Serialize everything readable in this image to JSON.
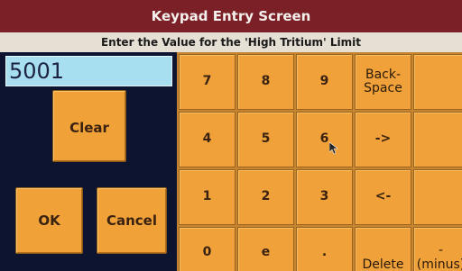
{
  "window": {
    "title": "Keypad Entry Screen"
  },
  "prompt": "Enter the Value for the 'High Tritium' Limit",
  "value_field": {
    "value": "5001"
  },
  "buttons": {
    "clear": "Clear",
    "ok": "OK",
    "cancel": "Cancel"
  },
  "keypad": {
    "keys": [
      {
        "name": "key-7",
        "label": "7"
      },
      {
        "name": "key-8",
        "label": "8"
      },
      {
        "name": "key-9",
        "label": "9"
      },
      {
        "name": "key-backspace",
        "label": "Back-\nSpace",
        "text": true
      },
      {
        "name": "key-blank-1",
        "label": "",
        "blank": true
      },
      {
        "name": "key-4",
        "label": "4"
      },
      {
        "name": "key-5",
        "label": "5"
      },
      {
        "name": "key-6",
        "label": "6"
      },
      {
        "name": "key-cursor-right",
        "label": "->"
      },
      {
        "name": "key-blank-2",
        "label": "",
        "blank": true
      },
      {
        "name": "key-1",
        "label": "1"
      },
      {
        "name": "key-2",
        "label": "2"
      },
      {
        "name": "key-3",
        "label": "3"
      },
      {
        "name": "key-cursor-left",
        "label": "<-"
      },
      {
        "name": "key-blank-3",
        "label": "",
        "blank": true
      },
      {
        "name": "key-0",
        "label": "0"
      },
      {
        "name": "key-e",
        "label": "e"
      },
      {
        "name": "key-decimal",
        "label": "."
      },
      {
        "name": "key-delete",
        "label": "Delete",
        "text": true,
        "bottom": true
      },
      {
        "name": "key-minus",
        "label": "-\n(minus)",
        "text": true,
        "bottom": true
      }
    ]
  },
  "colors": {
    "title_bar": "#7c2028",
    "key": "#f0a13a",
    "field": "#a8dff0",
    "panel": "#0d1430"
  }
}
